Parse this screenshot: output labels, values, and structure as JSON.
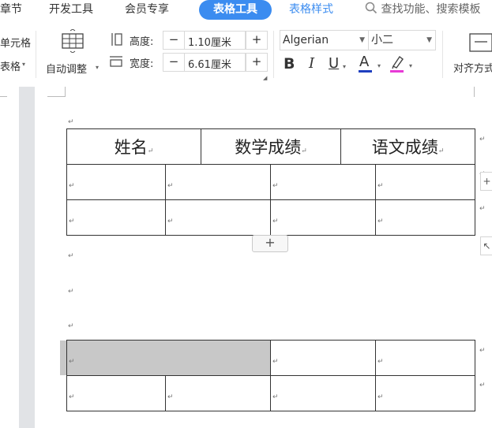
{
  "tabs": {
    "chapter": "章节",
    "developer": "开发工具",
    "member": "会员专享",
    "table_tools": "表格工具",
    "table_style": "表格样式",
    "search": "查找功能、搜索模板"
  },
  "ribbon": {
    "cell": "单元格",
    "table": "表格",
    "auto_adjust": "自动调整",
    "height_label": "高度:",
    "height_value": "1.10厘米",
    "width_label": "宽度:",
    "width_value": "6.61厘米",
    "minus": "−",
    "plus": "+",
    "font_name": "Algerian",
    "font_size": "小二",
    "bold": "B",
    "italic": "I",
    "underline": "U",
    "font_color": "A",
    "align": "对齐方式"
  },
  "colors": {
    "active_tab": "#3b8cf0",
    "font_color_bar": "#1f3fbf",
    "highlight_bar": "#e83ad6",
    "selected_cell": "#c8c8c8"
  },
  "document": {
    "header_row": [
      "姓名",
      "数学成绩",
      "语文成绩"
    ],
    "para_mark": "↵",
    "add_row": "+"
  }
}
